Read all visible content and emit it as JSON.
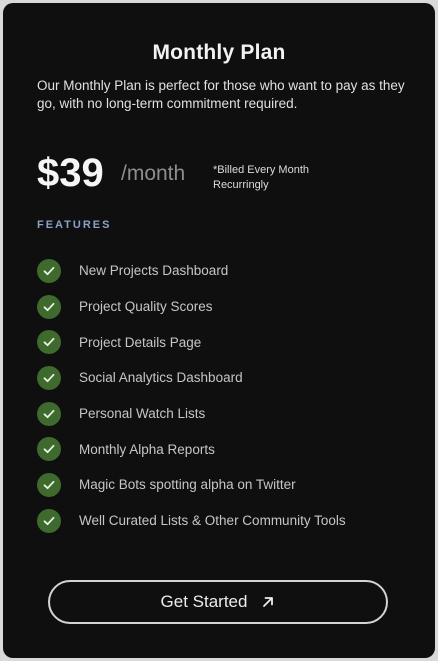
{
  "plan": {
    "title": "Monthly Plan",
    "description": "Our Monthly Plan is perfect for those who want to pay as they go, with no long-term commitment required.",
    "price": "$39",
    "period": "/month",
    "billing_note": "*Billed Every Month Recurringly"
  },
  "features": {
    "heading": "FEATURES",
    "items": [
      "New Projects Dashboard",
      "Project Quality Scores",
      "Project Details Page",
      "Social Analytics Dashboard",
      "Personal Watch Lists",
      "Monthly Alpha Reports",
      "Magic Bots spotting alpha on Twitter",
      "Well Curated Lists & Other Community Tools"
    ],
    "icon": "check-circle-icon"
  },
  "cta": {
    "label": "Get Started",
    "icon": "arrow-up-right-icon"
  },
  "colors": {
    "card_background": "#0f0f0f",
    "check_green": "#3f6a2e",
    "features_heading": "#8aa2c9",
    "price_period": "#8d8d8d"
  }
}
